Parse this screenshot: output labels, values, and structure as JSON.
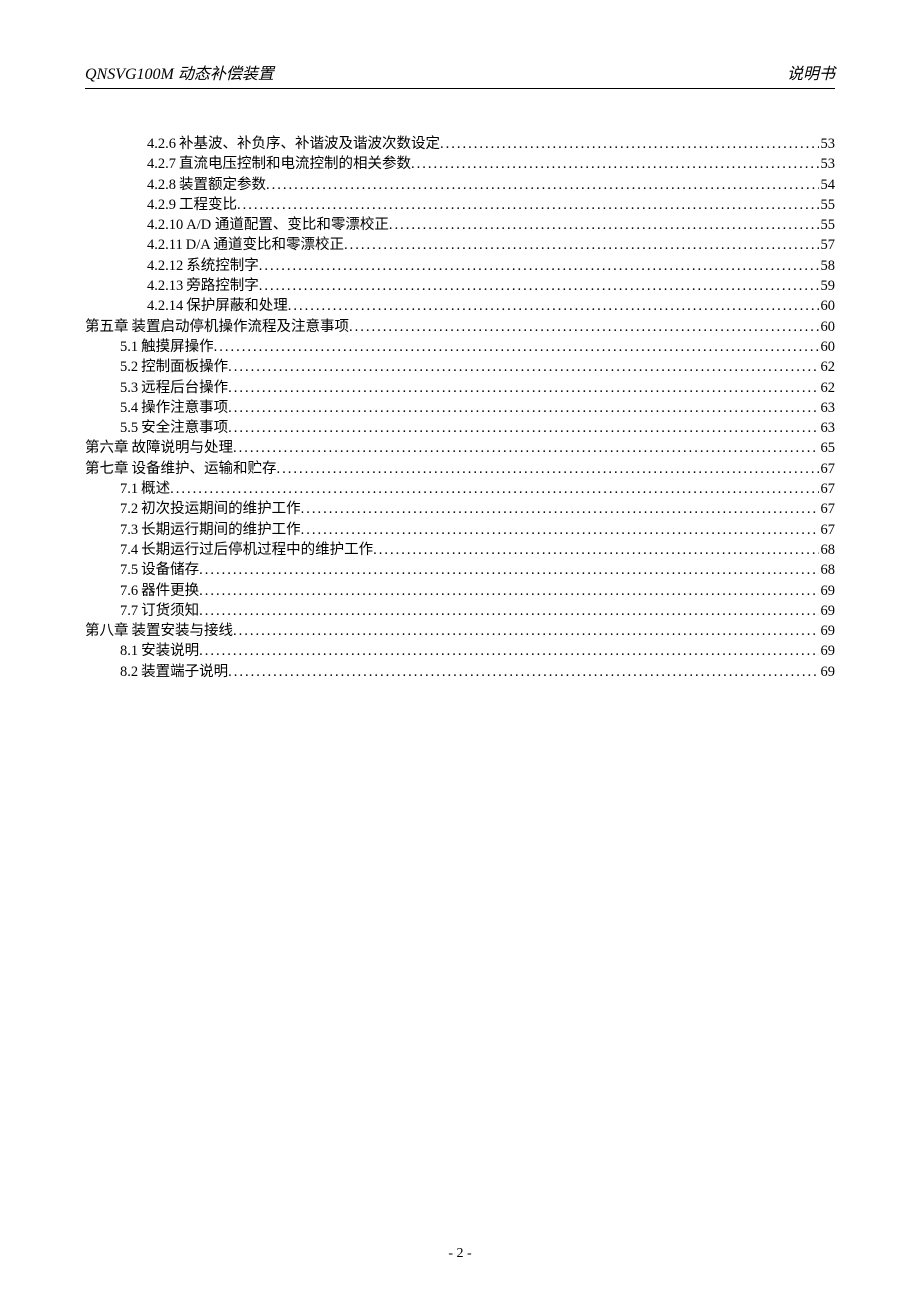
{
  "header": {
    "left": "QNSVG100M 动态补偿装置",
    "right": "说明书"
  },
  "toc_entries": [
    {
      "level": 3,
      "num": "4.2.6",
      "title": "补基波、补负序、补谐波及谐波次数设定",
      "page": "53"
    },
    {
      "level": 3,
      "num": "4.2.7",
      "title": "直流电压控制和电流控制的相关参数",
      "page": "53"
    },
    {
      "level": 3,
      "num": "4.2.8",
      "title": "装置额定参数",
      "page": "54"
    },
    {
      "level": 3,
      "num": "4.2.9",
      "title": "工程变比",
      "page": "55"
    },
    {
      "level": 3,
      "num": "4.2.10",
      "title": "A/D 通道配置、变比和零漂校正",
      "page": "55"
    },
    {
      "level": 3,
      "num": "4.2.11",
      "title": "D/A 通道变比和零漂校正",
      "page": "57"
    },
    {
      "level": 3,
      "num": "4.2.12",
      "title": "系统控制字",
      "page": "58"
    },
    {
      "level": 3,
      "num": "4.2.13",
      "title": "旁路控制字",
      "page": "59"
    },
    {
      "level": 3,
      "num": "4.2.14",
      "title": "保护屏蔽和处理",
      "page": "60"
    },
    {
      "level": 1,
      "num": "第五章",
      "title": "装置启动停机操作流程及注意事项",
      "page": "60"
    },
    {
      "level": 2,
      "num": "5.1",
      "title": "触摸屏操作",
      "page": "60"
    },
    {
      "level": 2,
      "num": "5.2",
      "title": "控制面板操作",
      "page": "62"
    },
    {
      "level": 2,
      "num": "5.3",
      "title": "远程后台操作",
      "page": "62"
    },
    {
      "level": 2,
      "num": "5.4",
      "title": "操作注意事项",
      "page": "63"
    },
    {
      "level": 2,
      "num": "5.5",
      "title": "安全注意事项",
      "page": "63"
    },
    {
      "level": 1,
      "num": "第六章",
      "title": "故障说明与处理",
      "page": "65"
    },
    {
      "level": 1,
      "num": "第七章",
      "title": "设备维护、运输和贮存",
      "page": "67"
    },
    {
      "level": 2,
      "num": "7.1",
      "title": "概述",
      "page": "67"
    },
    {
      "level": 2,
      "num": "7.2",
      "title": "初次投运期间的维护工作",
      "page": "67"
    },
    {
      "level": 2,
      "num": "7.3",
      "title": "长期运行期间的维护工作",
      "page": "67"
    },
    {
      "level": 2,
      "num": "7.4",
      "title": "长期运行过后停机过程中的维护工作",
      "page": "68"
    },
    {
      "level": 2,
      "num": "7.5",
      "title": "设备储存",
      "page": "68"
    },
    {
      "level": 2,
      "num": "7.6",
      "title": "器件更换",
      "page": "69"
    },
    {
      "level": 2,
      "num": "7.7",
      "title": "订货须知",
      "page": "69"
    },
    {
      "level": 1,
      "num": "第八章",
      "title": "装置安装与接线",
      "page": "69"
    },
    {
      "level": 2,
      "num": "8.1",
      "title": "安装说明",
      "page": "69"
    },
    {
      "level": 2,
      "num": "8.2",
      "title": "装置端子说明",
      "page": "69"
    }
  ],
  "footer": {
    "page_number": "- 2 -"
  }
}
